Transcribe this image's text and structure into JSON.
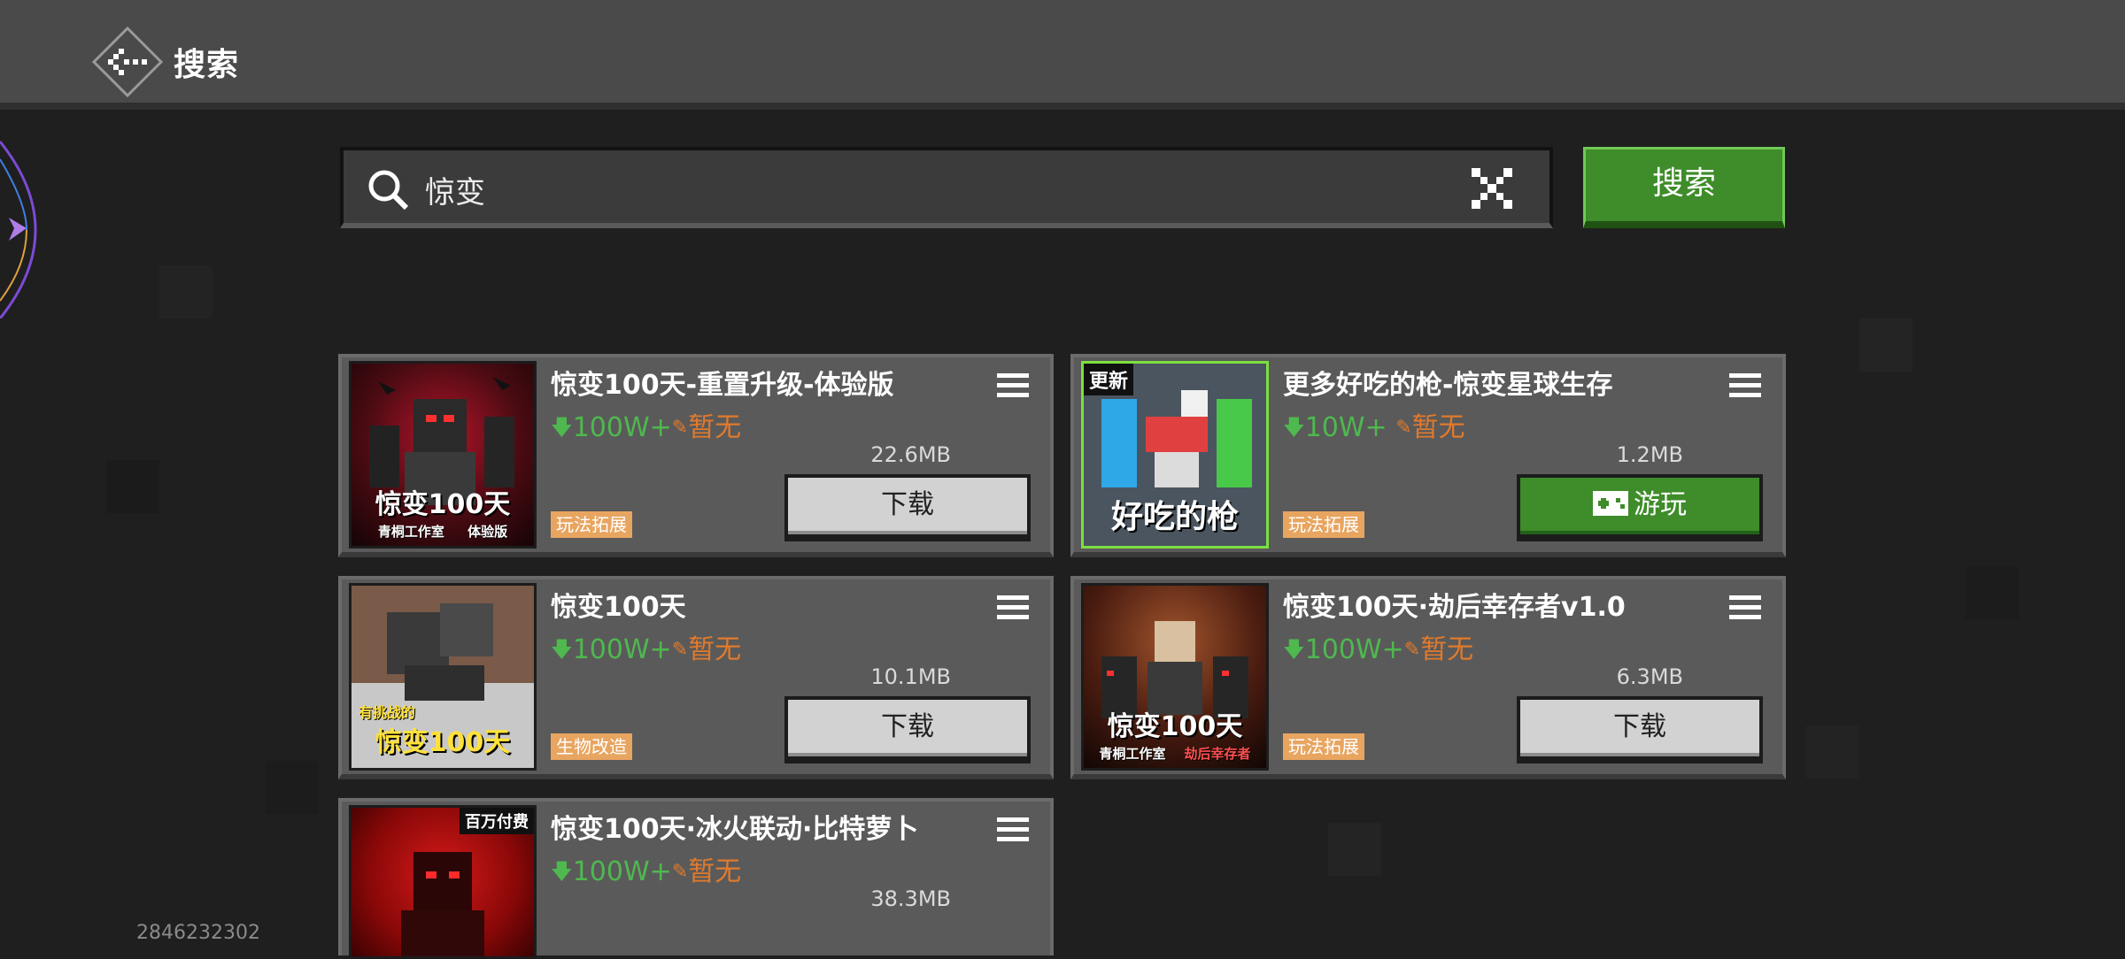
{
  "header": {
    "title": "搜索"
  },
  "search": {
    "query": "惊变",
    "button_label": "搜索"
  },
  "results": [
    {
      "title": "惊变100天-重置升级-体验版",
      "downloads": "100W+",
      "rating": "暂无",
      "size": "22.6MB",
      "tag": "玩法拓展",
      "action": "下载",
      "thumb": {
        "caption": "惊变100天",
        "sub_left": "青桐工作室",
        "sub_right": "体验版"
      }
    },
    {
      "title": "更多好吃的枪-惊变星球生存",
      "downloads": "10W+",
      "rating": "暂无",
      "size": "1.2MB",
      "tag": "玩法拓展",
      "action": "游玩",
      "thumb": {
        "badge": "更新",
        "caption": "好吃的枪"
      }
    },
    {
      "title": "惊变100天",
      "downloads": "100W+",
      "rating": "暂无",
      "size": "10.1MB",
      "tag": "生物改造",
      "action": "下载",
      "thumb": {
        "sub_top": "有挑战的",
        "caption": "惊变100天"
      }
    },
    {
      "title": "惊变100天·劫后幸存者v1.0",
      "downloads": "100W+",
      "rating": "暂无",
      "size": "6.3MB",
      "tag": "玩法拓展",
      "action": "下载",
      "thumb": {
        "caption": "惊变100天",
        "sub_left": "青桐工作室",
        "sub_right": "劫后幸存者"
      }
    },
    {
      "title": "惊变100天·冰火联动·比特萝卜",
      "downloads": "100W+",
      "rating": "暂无",
      "size": "38.3MB",
      "thumb": {
        "badge": "百万付费"
      }
    }
  ],
  "footer": {
    "id": "2846232302"
  },
  "colors": {
    "accent_green": "#3e8c2a",
    "download_count": "#4fb84f",
    "rating": "#e07a2d",
    "tag_bg": "#e8a560"
  }
}
